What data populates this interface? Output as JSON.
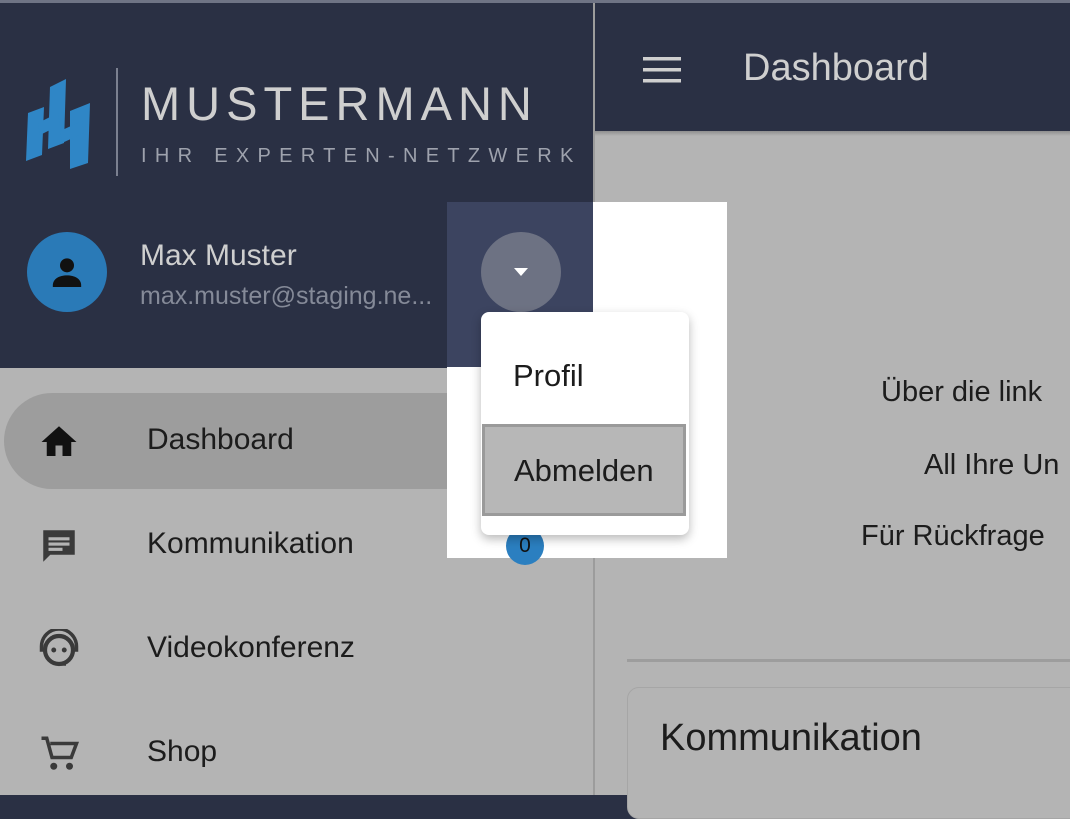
{
  "brand": {
    "title": "MUSTERMANN",
    "subtitle": "IHR EXPERTEN-NETZWERK"
  },
  "user": {
    "name": "Max Muster",
    "email": "max.muster@staging.ne..."
  },
  "sidebar": {
    "items": [
      {
        "label": "Dashboard",
        "icon": "home-icon",
        "active": true
      },
      {
        "label": "Kommunikation",
        "icon": "chat-icon",
        "badge": "0"
      },
      {
        "label": "Videokonferenz",
        "icon": "headset-icon"
      },
      {
        "label": "Shop",
        "icon": "cart-icon"
      }
    ]
  },
  "topbar": {
    "title": "Dashboard",
    "menu_icon": "hamburger-menu-icon"
  },
  "main": {
    "intro_lines": [
      "Über die link",
      "All Ihre Un",
      "Für Rückfrage"
    ],
    "card_title": "Kommunikation"
  },
  "user_menu": {
    "items": [
      {
        "label": "Profil"
      },
      {
        "label": "Abmelden",
        "selected": true
      }
    ]
  },
  "colors": {
    "header_bg": "#2a3044",
    "overlay_gray": "#b4b4b4",
    "avatar_blue": "#2a7ab7",
    "badge_blue": "#2b7fc0",
    "logo_blue": "#2f86c6"
  }
}
